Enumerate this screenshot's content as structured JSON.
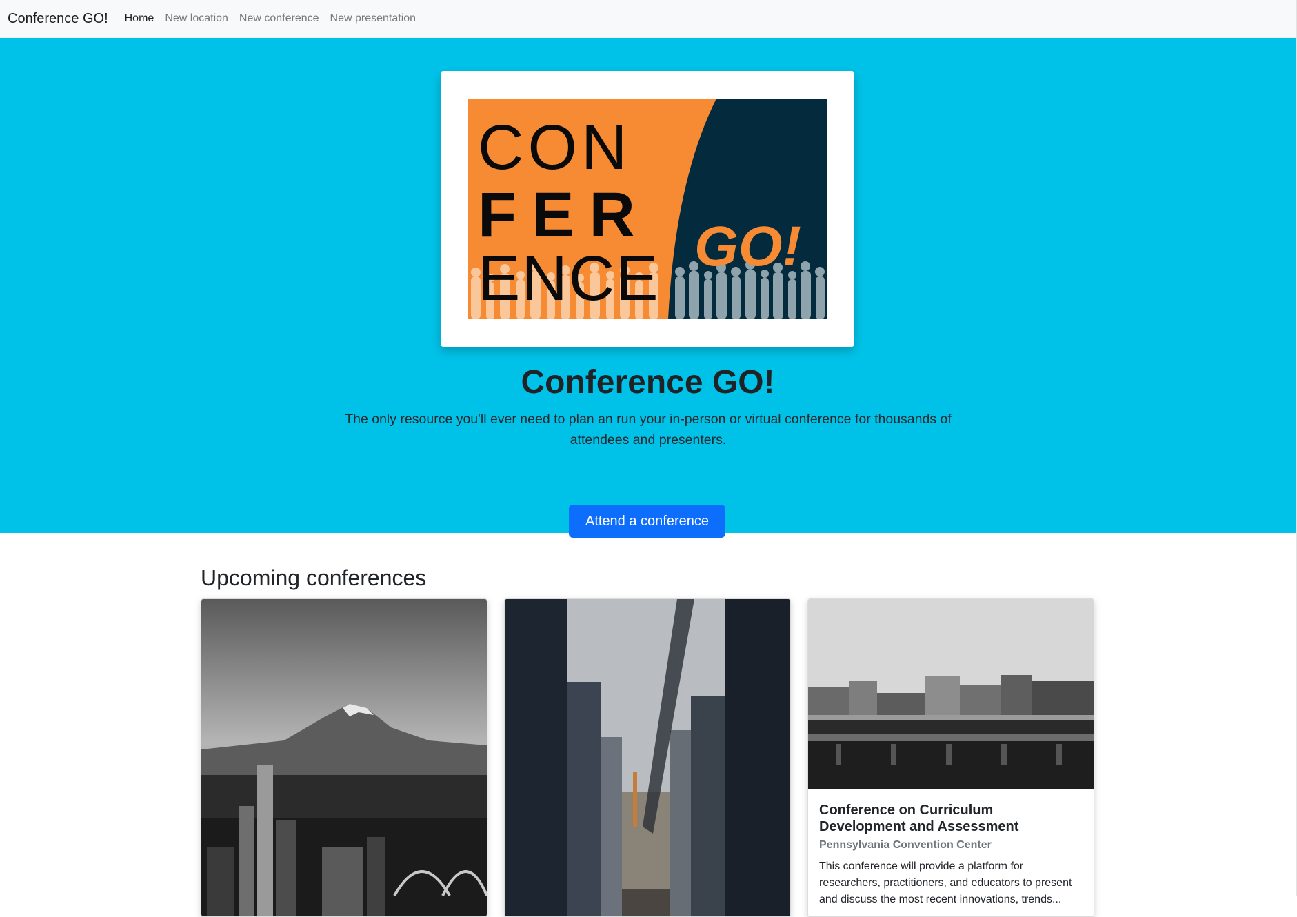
{
  "navbar": {
    "brand": "Conference GO!",
    "links": [
      "Home",
      "New location",
      "New conference",
      "New presentation"
    ]
  },
  "hero": {
    "logo_text": {
      "line1": "CON",
      "line2": "FER",
      "line3": "ENCE",
      "go": "GO!"
    },
    "title": "Conference GO!",
    "lead": "The only resource you'll ever need to plan an run your in-person or virtual conference for thousands of attendees and presenters.",
    "button_label": "Attend a conference"
  },
  "colors": {
    "hero_bg": "#00c2e8",
    "primary_button": "#0d6efd",
    "logo_orange": "#f68b33",
    "logo_navy": "#042b3d"
  },
  "section": {
    "title": "Upcoming conferences"
  },
  "conferences": [
    {
      "image": "mountain-city-photo",
      "title": "",
      "location": "",
      "description": ""
    },
    {
      "image": "skyscraper-street-photo",
      "title": "",
      "location": "",
      "description": ""
    },
    {
      "image": "city-bridge-photo",
      "title": "Conference on Curriculum Development and Assessment",
      "location": "Pennsylvania Convention Center",
      "description": "This conference will provide a platform for researchers, practitioners, and educators to present and discuss the most recent innovations, trends..."
    }
  ]
}
